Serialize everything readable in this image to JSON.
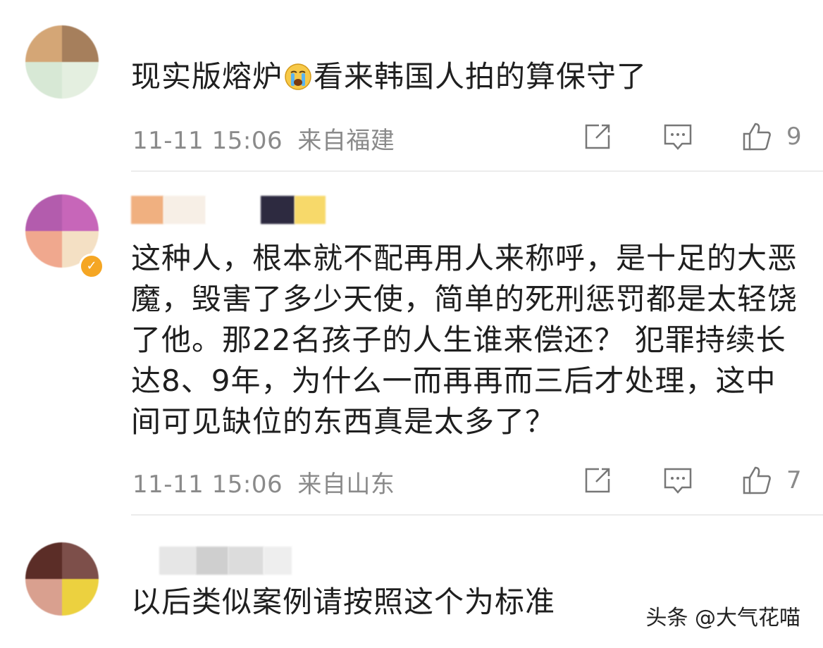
{
  "comments": [
    {
      "text_before_emoji": "现实版熔炉",
      "emoji": "crying-face",
      "text_after_emoji": "看来韩国人拍的算保守了",
      "time": "11-11 15:06",
      "location": "来自福建",
      "likes": "9"
    },
    {
      "text": "这种人，根本就不配再用人来称呼，是十足的大恶魔，毁害了多少天使，简单的死刑惩罚都是太轻饶了他。那22名孩子的人生谁来偿还？ 犯罪持续长达8、9年，为什么一而再再而三后才处理，这中间可见缺位的东西真是太多了？",
      "time": "11-11 15:06",
      "location": "来自山东",
      "likes": "7"
    },
    {
      "text": "以后类似案例请按照这个为标准"
    }
  ],
  "watermark": "头条 @大气花喵",
  "colors": {
    "meta_text": "#8a8a8a",
    "divider": "#ececec",
    "verified_badge": "#f5a623"
  },
  "icons": [
    "share-icon",
    "comment-icon",
    "like-icon"
  ]
}
